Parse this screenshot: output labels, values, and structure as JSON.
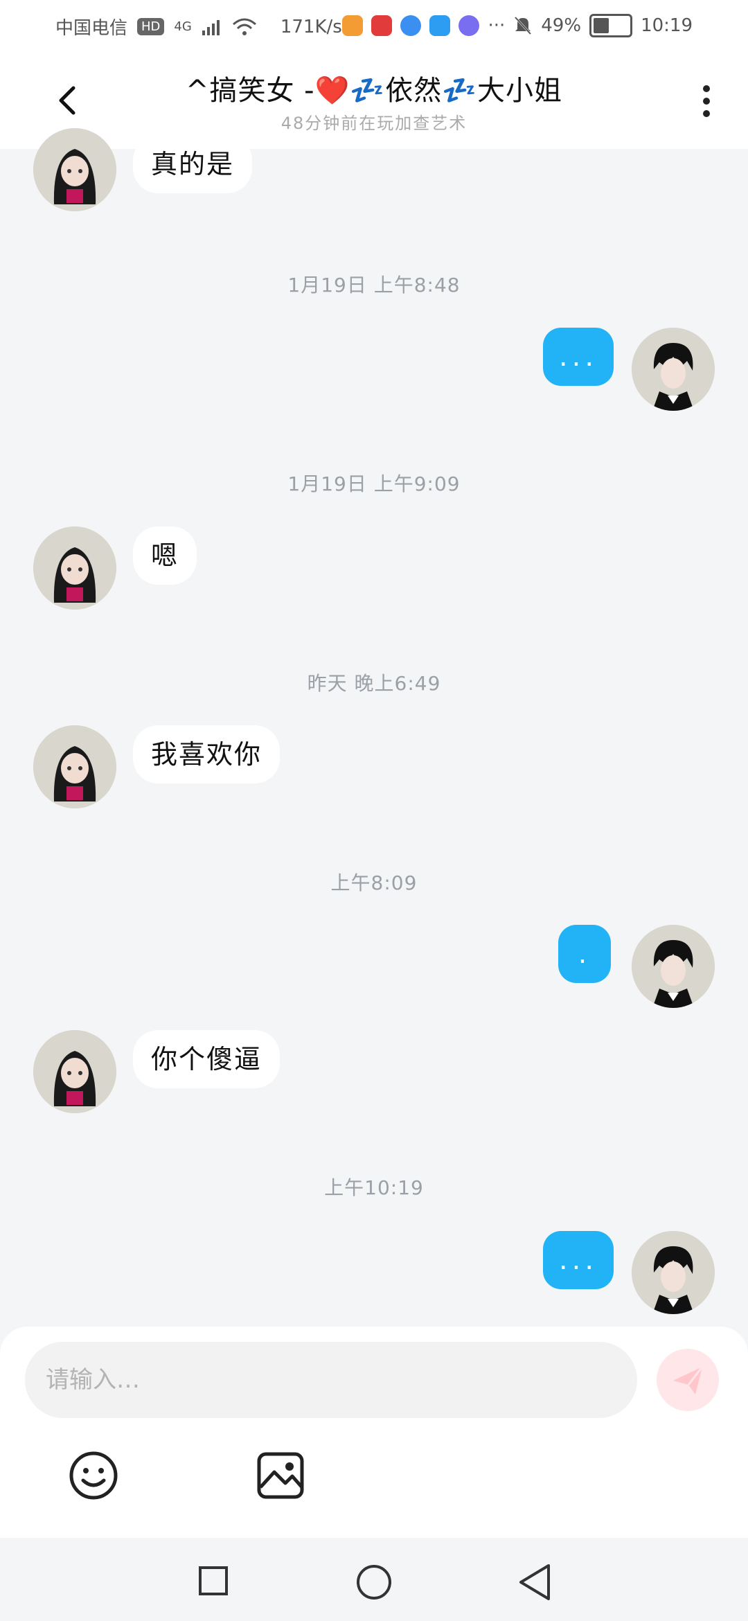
{
  "status": {
    "carrier": "中国电信",
    "hd": "HD",
    "network": "4G",
    "speed": "171K/s",
    "dots": "···",
    "battery": "49%",
    "battery_level": 0.49,
    "time": "10:19"
  },
  "header": {
    "title": "^搞笑女 -❤️💤依然💤大小姐",
    "subtitle": "48分钟前在玩加查艺术"
  },
  "messages": [
    {
      "type": "text",
      "side": "left",
      "text": "真的是"
    },
    {
      "type": "time",
      "text": "1月19日 上午8:48"
    },
    {
      "type": "text",
      "side": "right",
      "text": "..."
    },
    {
      "type": "time",
      "text": "1月19日 上午9:09"
    },
    {
      "type": "text",
      "side": "left",
      "text": "嗯"
    },
    {
      "type": "time",
      "text": "昨天 晚上6:49"
    },
    {
      "type": "text",
      "side": "left",
      "text": "我喜欢你"
    },
    {
      "type": "time",
      "text": "上午8:09"
    },
    {
      "type": "text",
      "side": "right",
      "text": "."
    },
    {
      "type": "text",
      "side": "left",
      "text": "你个傻逼"
    },
    {
      "type": "time",
      "text": "上午10:19"
    },
    {
      "type": "text",
      "side": "right",
      "text": "..."
    }
  ],
  "composer": {
    "placeholder": "请输入…"
  },
  "colors": {
    "accent": "#22b3f6",
    "send_disabled": "#ffe6e8"
  },
  "icons": [
    "back-arrow-icon",
    "more-vertical-icon",
    "send-icon",
    "emoji-icon",
    "image-icon",
    "nav-recent-icon",
    "nav-home-icon",
    "nav-back-icon"
  ]
}
